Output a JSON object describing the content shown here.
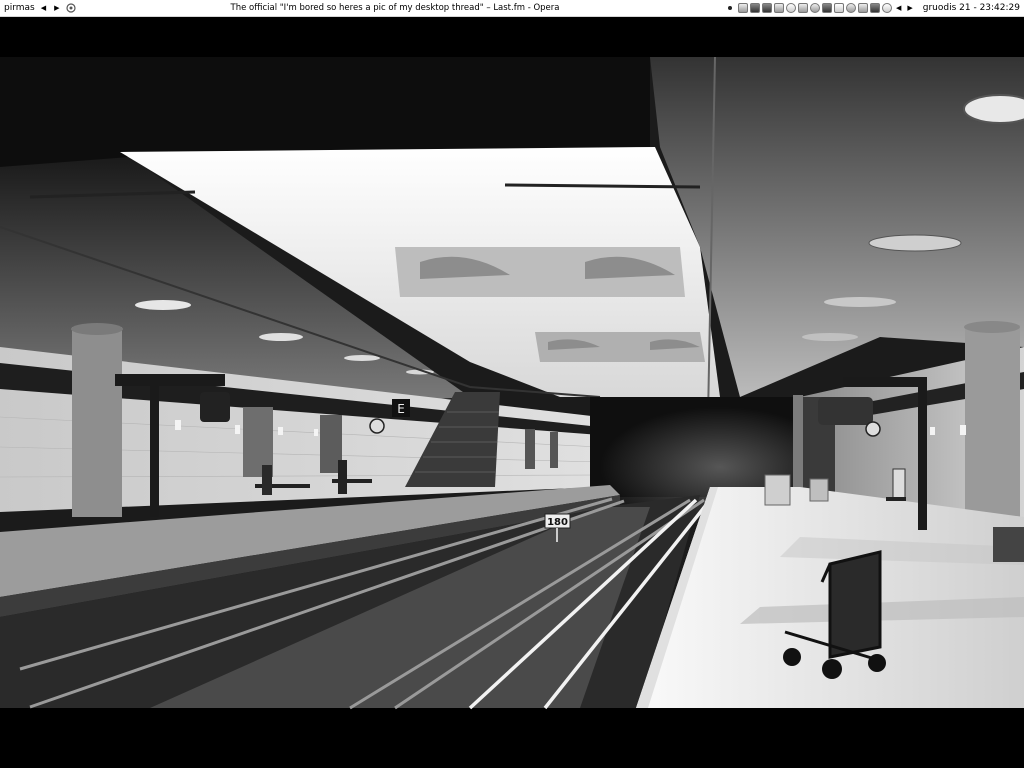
{
  "taskbar": {
    "workspace_name": "pirmas",
    "window_title": "The official \"I'm bored so heres a pic of my desktop thread\" – Last.fm - Opera",
    "clock": "gruodis 21 - 23:42:29",
    "tray_icons": [
      "network-icon",
      "app-icon",
      "terminal-icon",
      "settings-icon",
      "chat-icon",
      "download-icon",
      "shield-icon",
      "mail-icon",
      "media-icon",
      "sync-icon",
      "bluetooth-icon",
      "update-icon",
      "power-icon",
      "display-icon"
    ]
  },
  "wallpaper": {
    "subject": "",
    "sign_letter": "E",
    "speed_sign": "180"
  }
}
